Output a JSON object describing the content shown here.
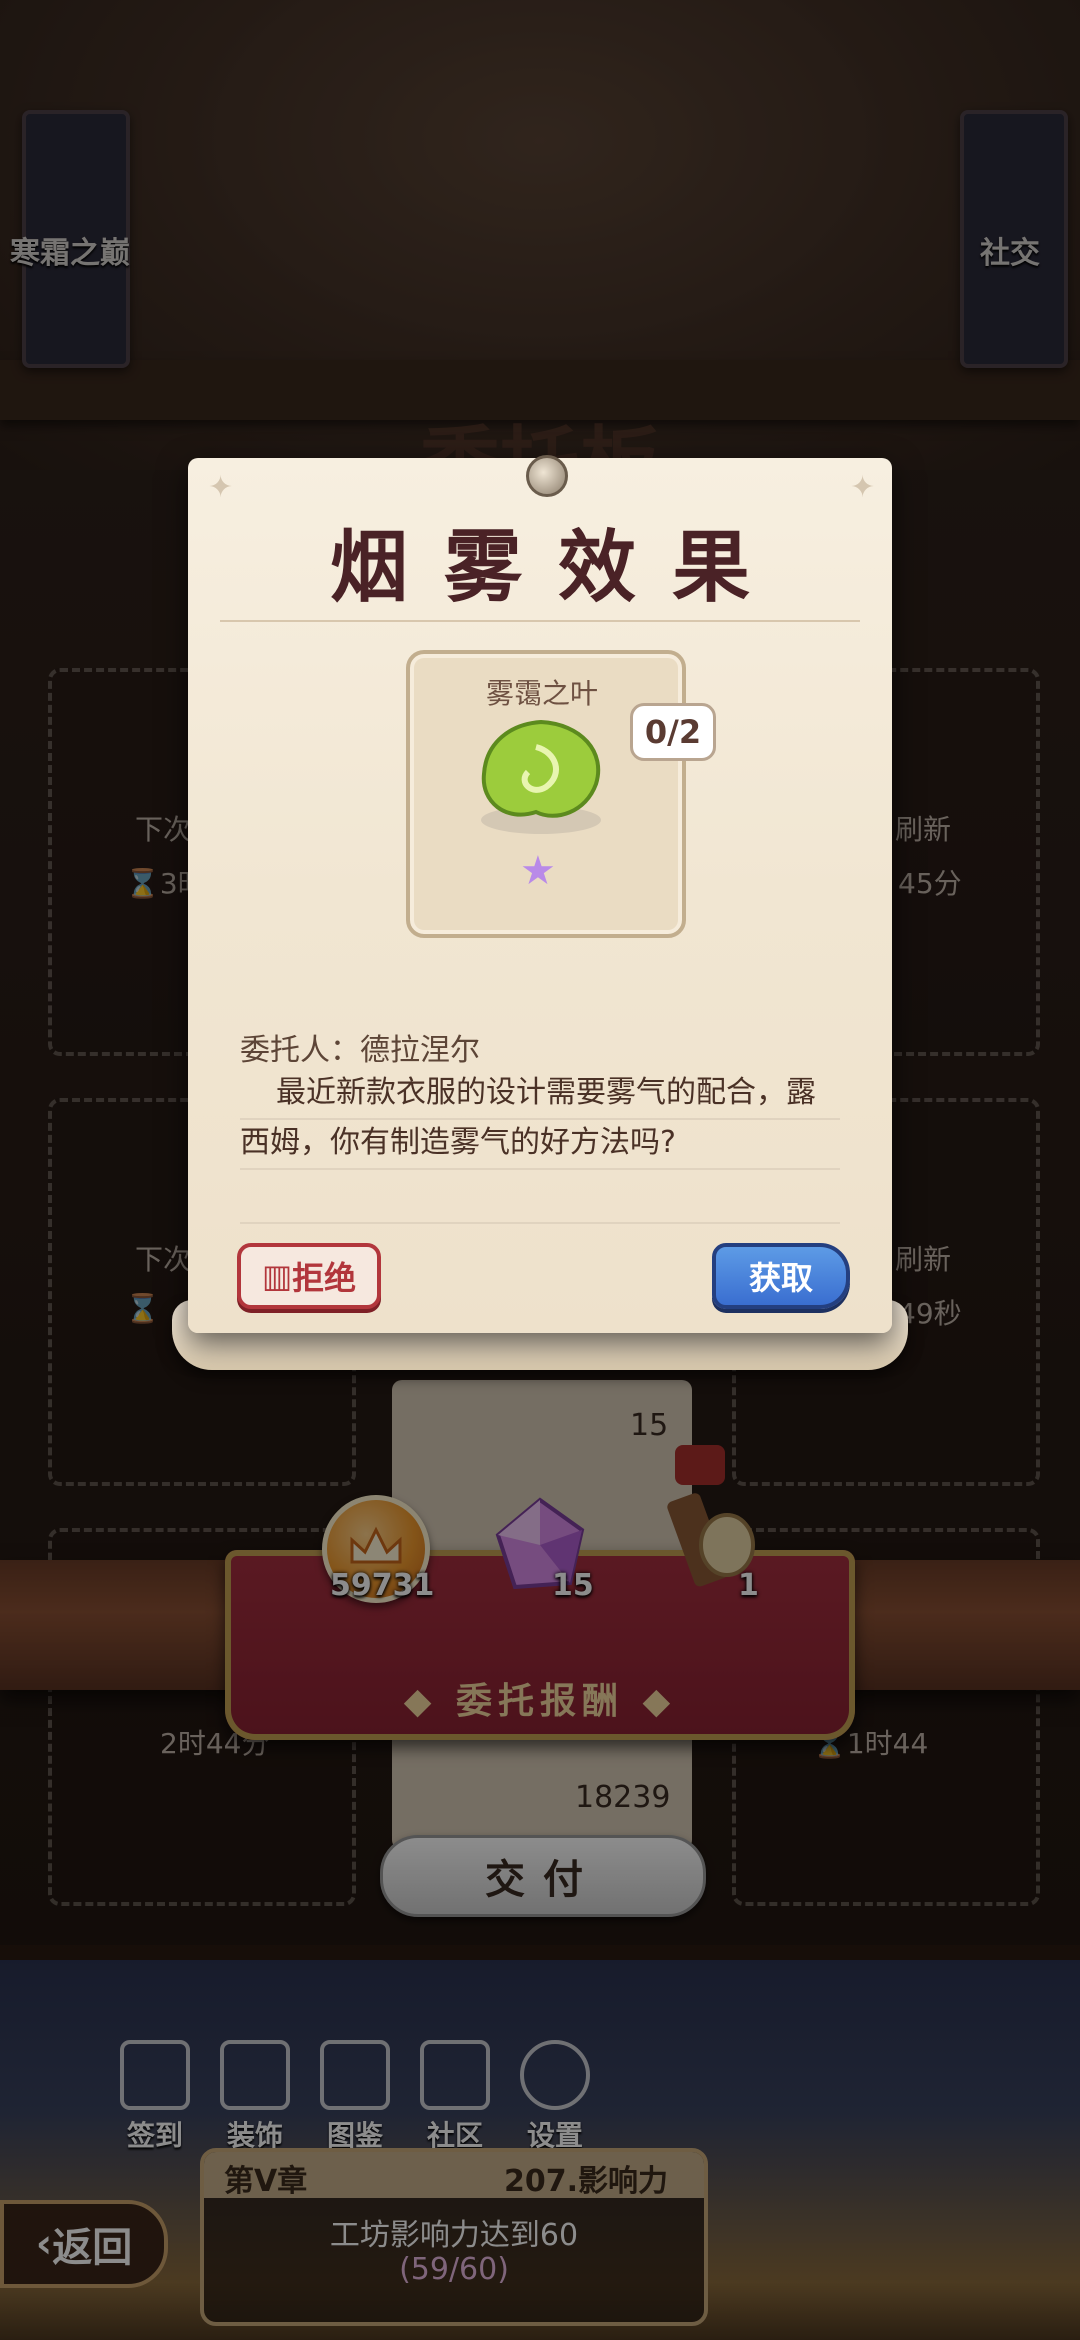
{
  "background": {
    "left_banner_label": "寒霜之巅",
    "right_banner_label": "社交",
    "board_title": "委托板",
    "slots": [
      {
        "line1": "下次",
        "line2": "⌛3时"
      },
      {
        "line1": "刷新",
        "line2": "45分"
      },
      {
        "line1": "下次",
        "line2": "⌛"
      },
      {
        "line1": "刷新",
        "line2": "49秒"
      },
      {
        "line1": "",
        "line2": "2时44分"
      },
      {
        "line1": "",
        "line2": "⌛1时44"
      }
    ],
    "lower_list": {
      "row1": "15",
      "row2": "18239"
    }
  },
  "rewards": {
    "title": "委托报酬",
    "items": [
      {
        "icon": "coin-icon",
        "value": "59731"
      },
      {
        "icon": "gem-icon",
        "value": "15"
      },
      {
        "icon": "material-bundle-icon",
        "value": "1"
      }
    ]
  },
  "deliver_button": "交付",
  "bottom_menu": [
    {
      "icon": "calendar-check-icon",
      "label": "签到"
    },
    {
      "icon": "decoration-icon",
      "label": "装饰"
    },
    {
      "icon": "book-icon",
      "label": "图鉴"
    },
    {
      "icon": "house-icon",
      "label": "社区"
    },
    {
      "icon": "gear-icon",
      "label": "设置"
    }
  ],
  "back_button": "返回",
  "chapter": {
    "name": "第V章",
    "influence": "207.影响力",
    "goal": "工坊影响力达到60",
    "progress": "(59/60)"
  },
  "dialog": {
    "title": "烟雾效果",
    "item_name": "雾霭之叶",
    "item_count": "0/2",
    "client": "委托人：德拉涅尔",
    "description": "最近新款衣服的设计需要雾气的配合，露西姆，你有制造雾气的好方法吗?",
    "reject_label": "拒绝",
    "obtain_label": "获取"
  },
  "colors": {
    "ribbon": "#a52f3f",
    "dialog_title": "#4a2226",
    "reject": "#b2363c",
    "obtain": "#3a6ed0"
  }
}
